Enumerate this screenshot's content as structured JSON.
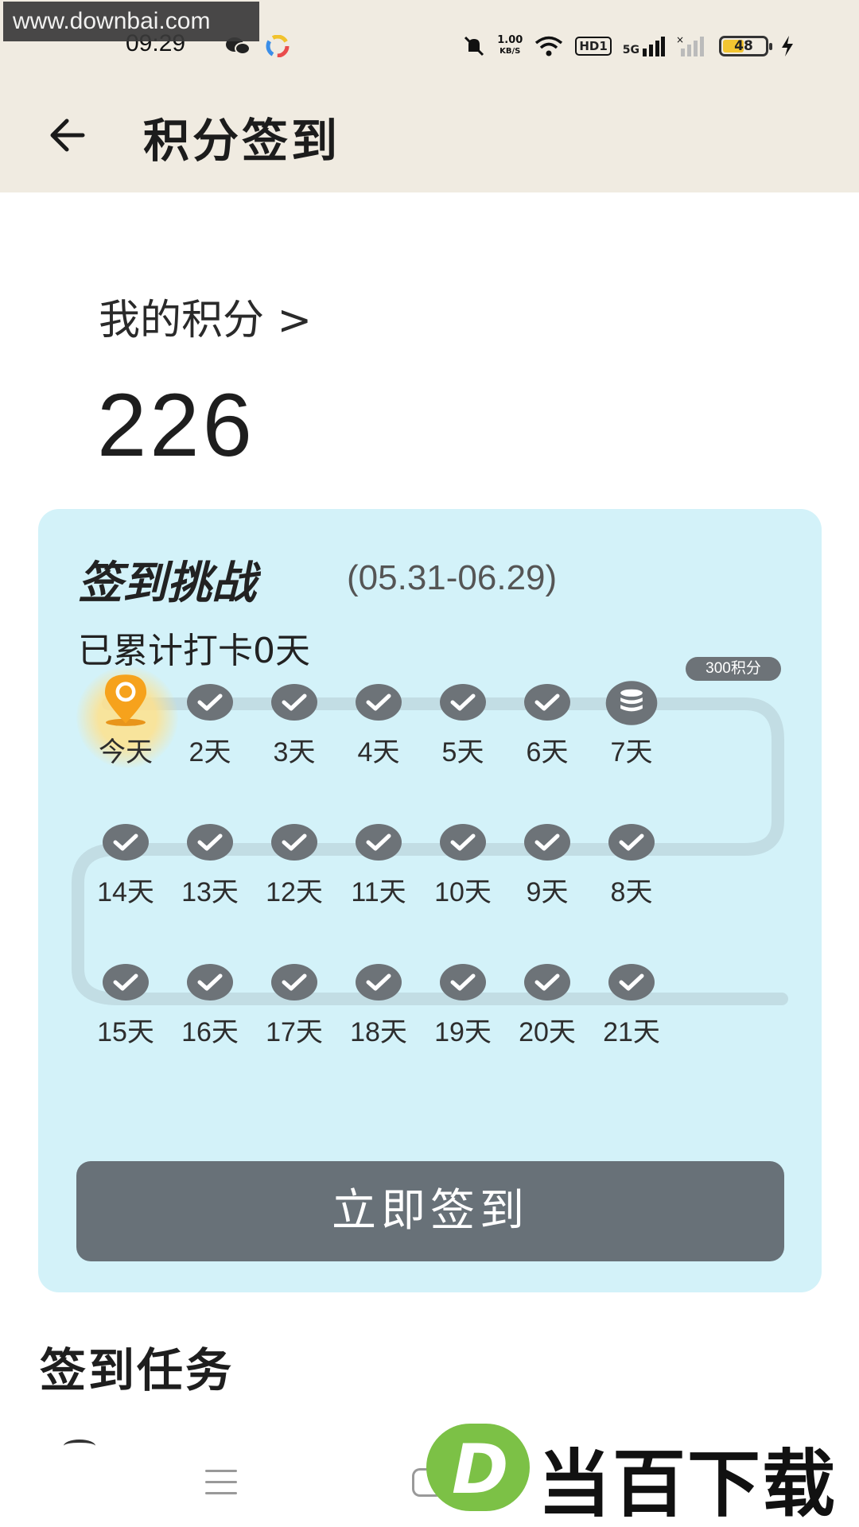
{
  "watermark": {
    "site": "www.downbai.com",
    "brand_text": "当百下载",
    "brand_glyph": "D"
  },
  "status_bar": {
    "time": "09:29",
    "net_speed_value": "1.00",
    "net_speed_unit": "KB/S",
    "hd": "HD1",
    "network": "5G",
    "battery": "48"
  },
  "header": {
    "title": "积分签到"
  },
  "points": {
    "label": "我的积分 >",
    "value": "226"
  },
  "challenge": {
    "title": "签到挑战",
    "date_range": "(05.31-06.29)",
    "streak": "已累计打卡0天",
    "reward_badge": "300积分",
    "button_label": "立即签到",
    "days": [
      {
        "label": "今天",
        "state": "today"
      },
      {
        "label": "2天",
        "state": "checked"
      },
      {
        "label": "3天",
        "state": "checked"
      },
      {
        "label": "4天",
        "state": "checked"
      },
      {
        "label": "5天",
        "state": "checked"
      },
      {
        "label": "6天",
        "state": "checked"
      },
      {
        "label": "7天",
        "state": "reward"
      },
      {
        "label": "8天",
        "state": "checked"
      },
      {
        "label": "9天",
        "state": "checked"
      },
      {
        "label": "10天",
        "state": "checked"
      },
      {
        "label": "11天",
        "state": "checked"
      },
      {
        "label": "12天",
        "state": "checked"
      },
      {
        "label": "13天",
        "state": "checked"
      },
      {
        "label": "14天",
        "state": "checked"
      },
      {
        "label": "15天",
        "state": "checked"
      },
      {
        "label": "16天",
        "state": "checked"
      },
      {
        "label": "17天",
        "state": "checked"
      },
      {
        "label": "18天",
        "state": "checked"
      },
      {
        "label": "19天",
        "state": "checked"
      },
      {
        "label": "20天",
        "state": "checked"
      },
      {
        "label": "21天",
        "state": "checked"
      }
    ]
  },
  "tasks": {
    "title": "签到任务"
  },
  "colors": {
    "card": "#d3f2f9",
    "header": "#f0ebe1",
    "button": "#687178",
    "check": "#6d7378",
    "pin": "#f6a21c"
  }
}
